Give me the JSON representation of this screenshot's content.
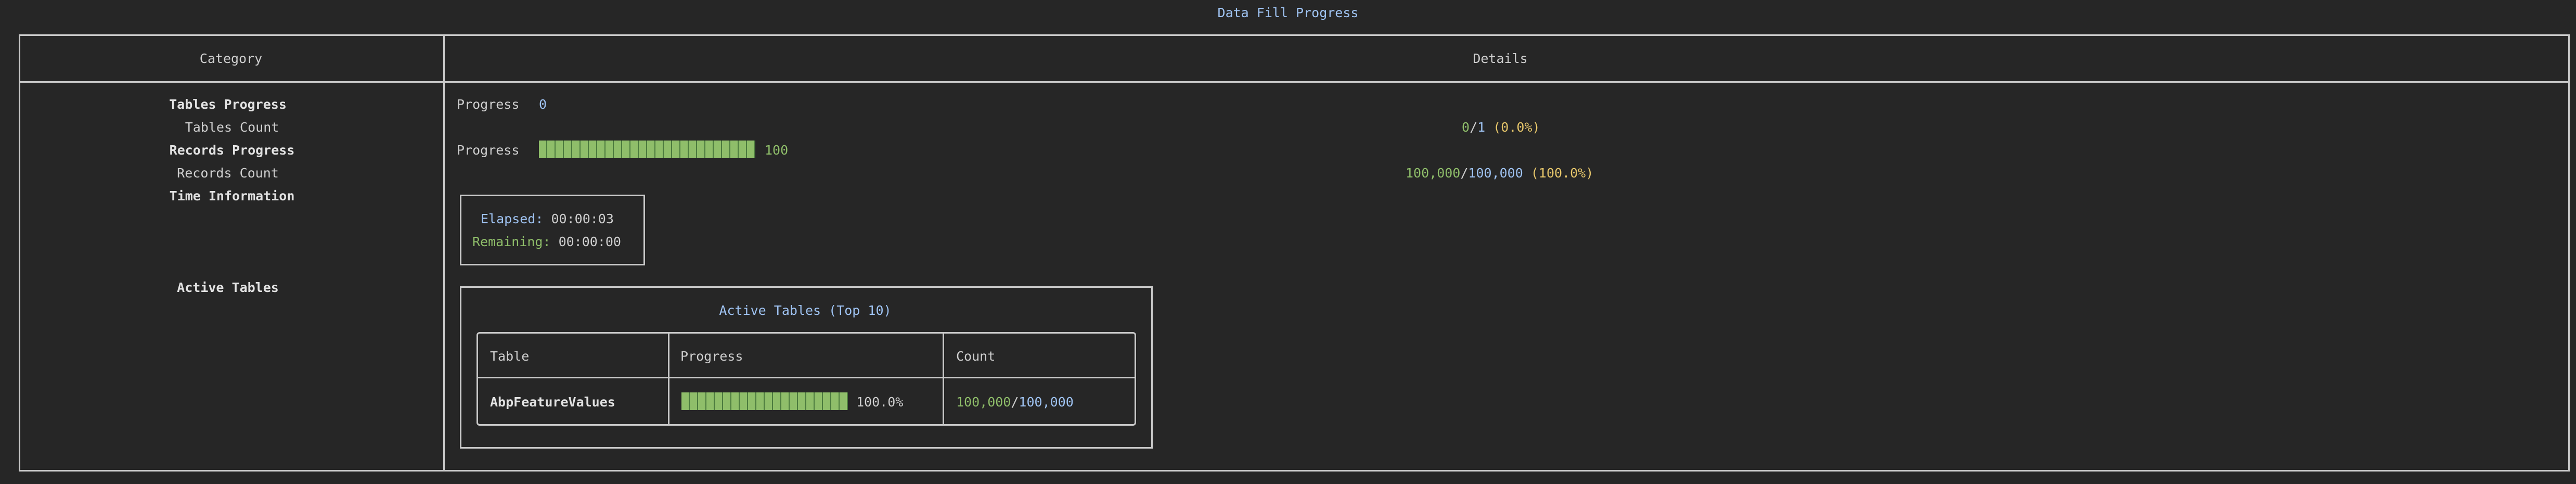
{
  "window_title": "Data Fill Progress",
  "columns": {
    "category": "Category",
    "details": "Details"
  },
  "rows": {
    "tables_progress": {
      "label": "Tables Progress",
      "progress_label": "Progress",
      "value": "0",
      "fraction": 0
    },
    "tables_count": {
      "label": "Tables Count",
      "done": "0",
      "slash": "/",
      "total": "1",
      "percent": "(0.0%)"
    },
    "records_progress": {
      "label": "Records Progress",
      "progress_label": "Progress",
      "value": "100",
      "fraction": 1
    },
    "records_count": {
      "label": "Records Count",
      "done": "100,000",
      "slash": "/",
      "total": "100,000",
      "percent": "(100.0%)"
    },
    "time_information": {
      "label": "Time Information",
      "elapsed_label": "Elapsed:",
      "elapsed_value": "00:00:03",
      "remaining_label": "Remaining:",
      "remaining_value": "00:00:00"
    },
    "active_tables": {
      "label": "Active Tables",
      "panel_title": "Active Tables (Top 10)",
      "headers": {
        "table": "Table",
        "progress": "Progress",
        "count": "Count"
      },
      "rows": [
        {
          "table": "AbpFeatureValues",
          "fraction": 1,
          "percent": "100.0%",
          "done": "100,000",
          "slash": "/",
          "total": "100,000"
        }
      ]
    }
  },
  "colors": {
    "accent": "#9fc3f2",
    "success": "#8fbe6a",
    "warning": "#e5c56a",
    "border": "#c9c9c9",
    "background": "#262626"
  }
}
